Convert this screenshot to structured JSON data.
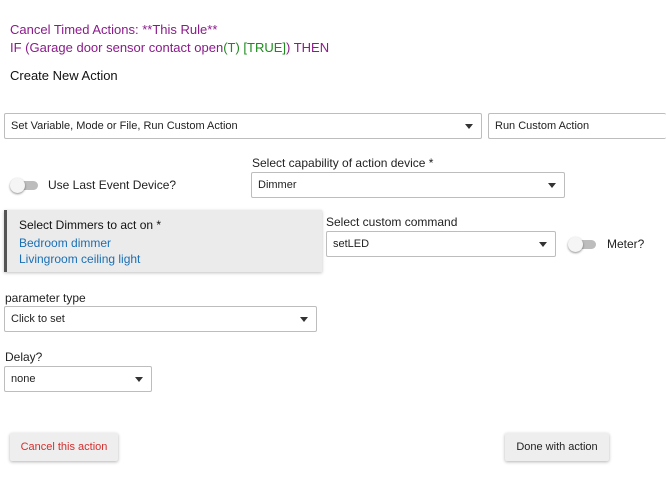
{
  "rule": {
    "line1": "Cancel Timed Actions: **This Rule**",
    "line2_if": "IF (Garage door sensor contact open",
    "line2_t": "(T) [TRUE]",
    "line2_then": ") THEN"
  },
  "section_heading": "Create New Action",
  "action_category": {
    "value": "Set Variable, Mode or File, Run Custom Action"
  },
  "action_type": {
    "value": "Run Custom Action"
  },
  "use_last_event": {
    "label": "Use Last Event Device?",
    "checked": false
  },
  "capability": {
    "label": "Select capability of action device *",
    "value": "Dimmer"
  },
  "devices": {
    "title": "Select Dimmers to act on *",
    "items": [
      "Bedroom dimmer",
      "Livingroom ceiling light"
    ]
  },
  "custom_command": {
    "label": "Select custom command",
    "value": "setLED"
  },
  "meter": {
    "label": "Meter?",
    "checked": false
  },
  "parameter_type": {
    "label": "parameter type",
    "value": "Click to set"
  },
  "delay": {
    "label": "Delay?",
    "value": "none"
  },
  "buttons": {
    "cancel": "Cancel this action",
    "done": "Done with action"
  },
  "colors": {
    "rule_text": "#8b1b8b",
    "true_text": "#1e8a1e",
    "device_link": "#1a6fb5",
    "cancel_text": "#d32f2f"
  }
}
